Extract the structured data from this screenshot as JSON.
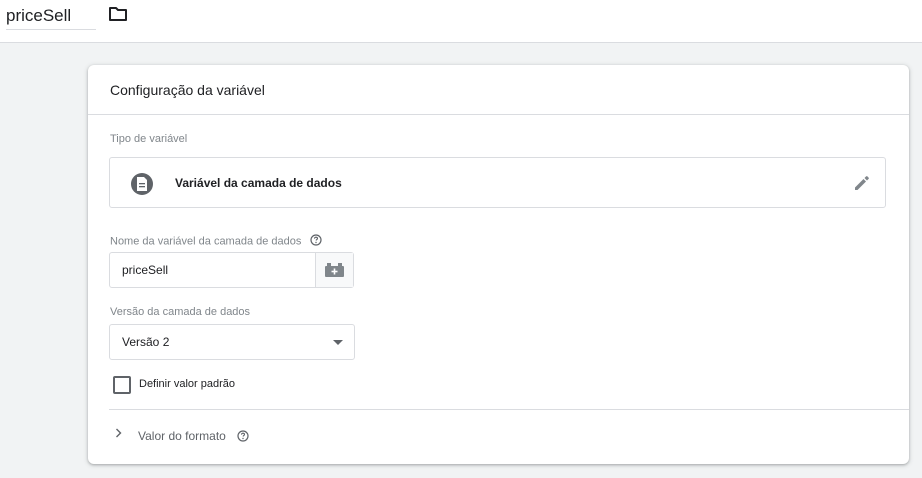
{
  "header": {
    "variable_name": "priceSell",
    "folder_icon": "folder-icon"
  },
  "card": {
    "title": "Configuração da variável",
    "variable_type": {
      "label": "Tipo de variável",
      "value": "Variável da camada de dados",
      "icon": "document-icon",
      "edit_icon": "pencil-icon"
    },
    "datalayer_name": {
      "label": "Nome da variável da camada de dados",
      "value": "priceSell",
      "help_icon": "help-circle-icon",
      "insert_icon": "insert-variable-icon"
    },
    "version": {
      "label": "Versão da camada de dados",
      "selected": "Versão 2"
    },
    "default_value": {
      "label": "Definir valor padrão",
      "checked": false
    },
    "format_value": {
      "label": "Valor do formato",
      "help_icon": "help-circle-icon"
    }
  },
  "colors": {
    "background": "#f1f3f4",
    "card": "#ffffff",
    "border": "#dadce0",
    "muted_text": "#80868b",
    "icon": "#5f6368"
  }
}
